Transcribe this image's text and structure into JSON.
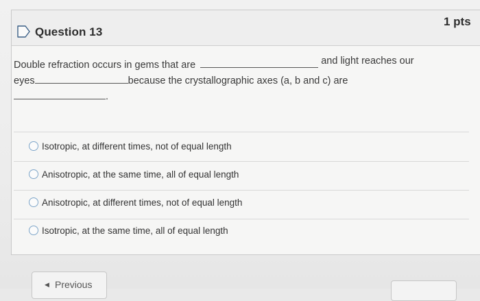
{
  "question": {
    "title": "Question 13",
    "points": "1 pts",
    "text_line1_a": "Double refraction occurs in gems that are",
    "text_line1_b": "and light reaches our",
    "text_line2_a": "eyes",
    "text_line2_b": "because the crystallographic axes (a, b and c) are",
    "text_line3_end": "."
  },
  "answers": [
    {
      "label": "Isotropic, at different times, not of equal length"
    },
    {
      "label": "Anisotropic, at the same time, all of equal length"
    },
    {
      "label": "Anisotropic, at different times, not of equal length"
    },
    {
      "label": "Isotropic, at the same time, all of equal length"
    }
  ],
  "navigation": {
    "previous_label": "Previous",
    "previous_icon": "chevron-left-icon"
  },
  "icons": {
    "flag": "flag-icon"
  },
  "colors": {
    "radio_border": "#7da5c9",
    "card_background": "#f6f6f5",
    "header_background": "#eeeeee"
  }
}
